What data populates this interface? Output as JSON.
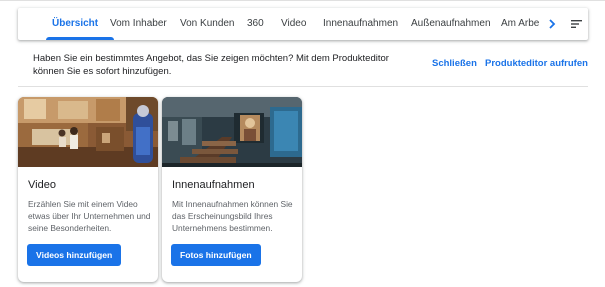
{
  "tabs": [
    {
      "label": "Übersicht",
      "active": true
    },
    {
      "label": "Vom Inhaber"
    },
    {
      "label": "Von Kunden"
    },
    {
      "label": "360"
    },
    {
      "label": "Video"
    },
    {
      "label": "Innenaufnahmen"
    },
    {
      "label": "Außenaufnahmen"
    },
    {
      "label": "Am Arbe"
    }
  ],
  "toolbar": {
    "scroll_icon": "chevron-right-icon",
    "menu_icon": "sort-menu-icon"
  },
  "banner": {
    "text": "Haben Sie ein bestimmtes Angebot, das Sie zeigen möchten? Mit dem Produkteditor können Sie es sofort hinzufügen.",
    "close_label": "Schließen",
    "editor_label": "Produkteditor aufrufen"
  },
  "cards": [
    {
      "title": "Video",
      "description": "Erzählen Sie mit einem Video etwas über Ihr Unternehmen und seine Besonderheiten.",
      "button_label": "Videos hinzufügen"
    },
    {
      "title": "Innenaufnahmen",
      "description": "Mit Innenaufnahmen können Sie das Erscheinungsbild Ihres Unternehmens bestimmen.",
      "button_label": "Fotos hinzufügen"
    }
  ],
  "colors": {
    "accent": "#1a73e8",
    "text_primary": "#202124",
    "text_secondary": "#5f6368"
  }
}
